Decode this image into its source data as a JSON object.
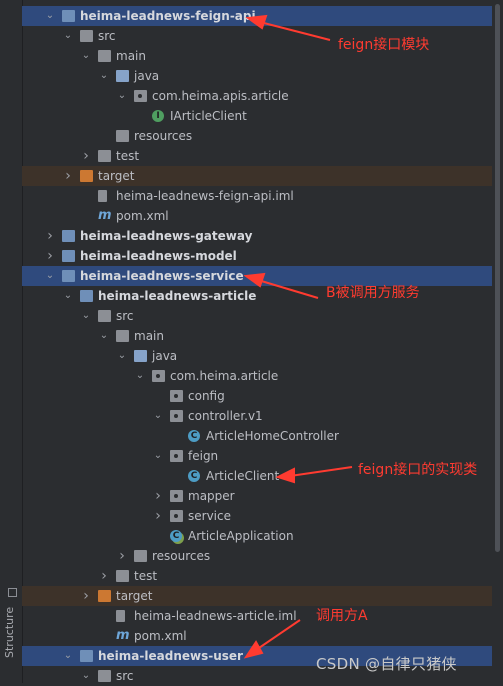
{
  "sidebar": {
    "structure_label": "Structure"
  },
  "tree": [
    {
      "label": "heima-leadnews-feign-api",
      "indent": 1,
      "chev": "down",
      "icon": "module-folder",
      "state": "selected",
      "bold": true
    },
    {
      "label": "src",
      "indent": 2,
      "chev": "down",
      "icon": "folder",
      "state": "",
      "bold": false
    },
    {
      "label": "main",
      "indent": 3,
      "chev": "down",
      "icon": "folder",
      "state": "",
      "bold": false
    },
    {
      "label": "java",
      "indent": 4,
      "chev": "down",
      "icon": "source-folder",
      "state": "",
      "bold": false
    },
    {
      "label": "com.heima.apis.article",
      "indent": 5,
      "chev": "down",
      "icon": "package",
      "state": "",
      "bold": false
    },
    {
      "label": "IArticleClient",
      "indent": 6,
      "chev": "",
      "icon": "interface",
      "state": "",
      "bold": false
    },
    {
      "label": "resources",
      "indent": 4,
      "chev": "",
      "icon": "resources-folder",
      "state": "",
      "bold": false
    },
    {
      "label": "test",
      "indent": 3,
      "chev": "right",
      "icon": "folder",
      "state": "",
      "bold": false
    },
    {
      "label": "target",
      "indent": 2,
      "chev": "right",
      "icon": "target-folder",
      "state": "target",
      "bold": false
    },
    {
      "label": "heima-leadnews-feign-api.iml",
      "indent": 3,
      "chev": "",
      "icon": "iml-file",
      "state": "",
      "bold": false
    },
    {
      "label": "pom.xml",
      "indent": 3,
      "chev": "",
      "icon": "maven-file",
      "state": "",
      "bold": false
    },
    {
      "label": "heima-leadnews-gateway",
      "indent": 1,
      "chev": "right",
      "icon": "module-folder",
      "state": "",
      "bold": true
    },
    {
      "label": "heima-leadnews-model",
      "indent": 1,
      "chev": "right",
      "icon": "module-folder",
      "state": "",
      "bold": true
    },
    {
      "label": "heima-leadnews-service",
      "indent": 1,
      "chev": "down",
      "icon": "module-folder",
      "state": "selected",
      "bold": true
    },
    {
      "label": "heima-leadnews-article",
      "indent": 2,
      "chev": "down",
      "icon": "module-folder",
      "state": "",
      "bold": true
    },
    {
      "label": "src",
      "indent": 3,
      "chev": "down",
      "icon": "folder",
      "state": "",
      "bold": false
    },
    {
      "label": "main",
      "indent": 4,
      "chev": "down",
      "icon": "folder",
      "state": "",
      "bold": false
    },
    {
      "label": "java",
      "indent": 5,
      "chev": "down",
      "icon": "source-folder",
      "state": "",
      "bold": false
    },
    {
      "label": "com.heima.article",
      "indent": 6,
      "chev": "down",
      "icon": "package",
      "state": "",
      "bold": false
    },
    {
      "label": "config",
      "indent": 7,
      "chev": "",
      "icon": "package",
      "state": "",
      "bold": false
    },
    {
      "label": "controller.v1",
      "indent": 7,
      "chev": "down",
      "icon": "package",
      "state": "",
      "bold": false
    },
    {
      "label": "ArticleHomeController",
      "indent": 8,
      "chev": "",
      "icon": "class",
      "state": "",
      "bold": false
    },
    {
      "label": "feign",
      "indent": 7,
      "chev": "down",
      "icon": "package",
      "state": "",
      "bold": false
    },
    {
      "label": "ArticleClient",
      "indent": 8,
      "chev": "",
      "icon": "class",
      "state": "",
      "bold": false
    },
    {
      "label": "mapper",
      "indent": 7,
      "chev": "right",
      "icon": "package",
      "state": "",
      "bold": false
    },
    {
      "label": "service",
      "indent": 7,
      "chev": "right",
      "icon": "package",
      "state": "",
      "bold": false
    },
    {
      "label": "ArticleApplication",
      "indent": 7,
      "chev": "",
      "icon": "app-class",
      "state": "",
      "bold": false
    },
    {
      "label": "resources",
      "indent": 5,
      "chev": "right",
      "icon": "resources-folder",
      "state": "",
      "bold": false
    },
    {
      "label": "test",
      "indent": 4,
      "chev": "right",
      "icon": "folder",
      "state": "",
      "bold": false
    },
    {
      "label": "target",
      "indent": 3,
      "chev": "right",
      "icon": "target-folder",
      "state": "target",
      "bold": false
    },
    {
      "label": "heima-leadnews-article.iml",
      "indent": 4,
      "chev": "",
      "icon": "iml-file",
      "state": "",
      "bold": false
    },
    {
      "label": "pom.xml",
      "indent": 4,
      "chev": "",
      "icon": "maven-file",
      "state": "",
      "bold": false
    },
    {
      "label": "heima-leadnews-user",
      "indent": 2,
      "chev": "down",
      "icon": "module-folder",
      "state": "selected",
      "bold": true
    },
    {
      "label": "src",
      "indent": 3,
      "chev": "down",
      "icon": "folder",
      "state": "",
      "bold": false
    }
  ],
  "annotations": {
    "feign_module": "feign接口模块",
    "service_b": "B被调用方服务",
    "feign_impl": "feign接口的实现类",
    "caller_a": "调用方A"
  },
  "watermark": "CSDN @自律只猪侠",
  "colors": {
    "selection": "#2f4a7d",
    "target_row": "#3d3229",
    "annotation": "#ff3b30"
  }
}
